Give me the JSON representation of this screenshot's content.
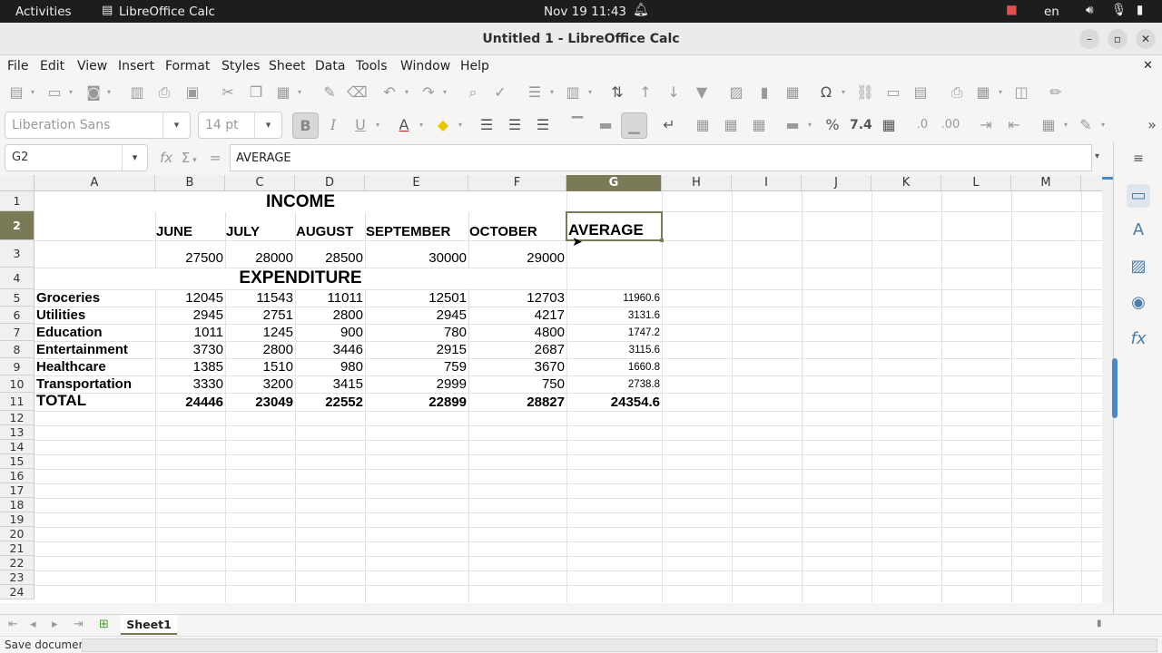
{
  "topbar": {
    "activities": "Activities",
    "app_name": "LibreOffice Calc",
    "datetime": "Nov 19  11:43",
    "language": "en"
  },
  "window": {
    "title": "Untitled 1 - LibreOffice Calc"
  },
  "menu": [
    "File",
    "Edit",
    "View",
    "Insert",
    "Format",
    "Styles",
    "Sheet",
    "Data",
    "Tools",
    "Window",
    "Help"
  ],
  "format_toolbar": {
    "font_name": "Liberation Sans",
    "font_size": "14 pt",
    "bold": "B",
    "italic": "I",
    "underline": "U",
    "percent": "%",
    "number_format": "7.4",
    "add_decimal": ".0",
    "remove_decimal": ".00"
  },
  "formula_bar": {
    "name_box": "G2",
    "content": "AVERAGE",
    "equals": "="
  },
  "columns": [
    "A",
    "B",
    "C",
    "D",
    "E",
    "F",
    "G",
    "H",
    "I",
    "J",
    "K",
    "L",
    "M"
  ],
  "selected_column": "G",
  "rows": [
    "1",
    "2",
    "3",
    "4",
    "5",
    "6",
    "7",
    "8",
    "9",
    "10",
    "11",
    "12",
    "13",
    "14",
    "15",
    "16",
    "17",
    "18",
    "19",
    "20",
    "21",
    "22",
    "23",
    "24"
  ],
  "selected_row": "2",
  "sheet": {
    "income_title": "INCOME",
    "months": [
      "JUNE",
      "JULY",
      "AUGUST",
      "SEPTEMBER",
      "OCTOBER"
    ],
    "average_header": "AVERAGE",
    "income_values": [
      "27500",
      "28000",
      "28500",
      "30000",
      "29000"
    ],
    "expenditure_title": "EXPENDITURE",
    "expense_rows": [
      {
        "label": "Groceries",
        "values": [
          "12045",
          "11543",
          "11011",
          "12501",
          "12703"
        ],
        "avg": "11960.6"
      },
      {
        "label": "Utilities",
        "values": [
          "2945",
          "2751",
          "2800",
          "2945",
          "4217"
        ],
        "avg": "3131.6"
      },
      {
        "label": "Education",
        "values": [
          "1011",
          "1245",
          "900",
          "780",
          "4800"
        ],
        "avg": "1747.2"
      },
      {
        "label": "Entertainment",
        "values": [
          "3730",
          "2800",
          "3446",
          "2915",
          "2687"
        ],
        "avg": "3115.6"
      },
      {
        "label": "Healthcare",
        "values": [
          "1385",
          "1510",
          "980",
          "759",
          "3670"
        ],
        "avg": "1660.8"
      },
      {
        "label": "Transportation",
        "values": [
          "3330",
          "3200",
          "3415",
          "2999",
          "750"
        ],
        "avg": "2738.8"
      }
    ],
    "total_label": "TOTAL",
    "total_values": [
      "24446",
      "23049",
      "22552",
      "22899",
      "28827"
    ],
    "total_avg": "24354.6"
  },
  "tabs": {
    "sheet_name": "Sheet1"
  },
  "status": {
    "text": "Save document"
  }
}
